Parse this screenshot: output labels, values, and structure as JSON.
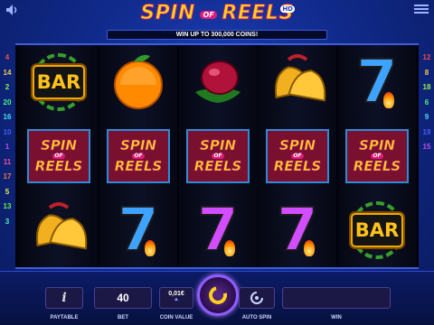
{
  "game": {
    "logo_word1": "SPIN",
    "logo_of": "OF",
    "logo_word2": "REELS",
    "logo_badge": "HD",
    "banner": "WIN UP TO 300,000 COINS!"
  },
  "paylines_left": [
    "4",
    "14",
    "2",
    "20",
    "16",
    "10",
    "1",
    "11",
    "17",
    "5",
    "13",
    "3"
  ],
  "paylines_right": [
    "12",
    "8",
    "18",
    "6",
    "9",
    "19",
    "15"
  ],
  "reels": [
    [
      "bar",
      "spin-of-reels",
      "bells"
    ],
    [
      "orange",
      "spin-of-reels",
      "blue-seven"
    ],
    [
      "plum",
      "spin-of-reels",
      "purple-seven"
    ],
    [
      "bells",
      "spin-of-reels",
      "purple-seven"
    ],
    [
      "blue-seven",
      "spin-of-reels",
      "bar"
    ]
  ],
  "symbols": {
    "bar_text": "BAR",
    "seven_text": "7",
    "tile_word1": "SPIN",
    "tile_of": "OF",
    "tile_word2": "REELS"
  },
  "controls": {
    "info_label": "i",
    "paytable_label": "PAYTABLE",
    "bet_value": "40",
    "bet_label": "BET",
    "coin_value": "0,01€",
    "coin_value_label": "COIN VALUE",
    "autospin_label": "AUTO SPIN",
    "win_label": "WIN",
    "win_value": ""
  },
  "colors": {
    "background": "#102a8a",
    "accent_gold": "#ffd11a",
    "spin_button_ring": "#8f5cff"
  }
}
